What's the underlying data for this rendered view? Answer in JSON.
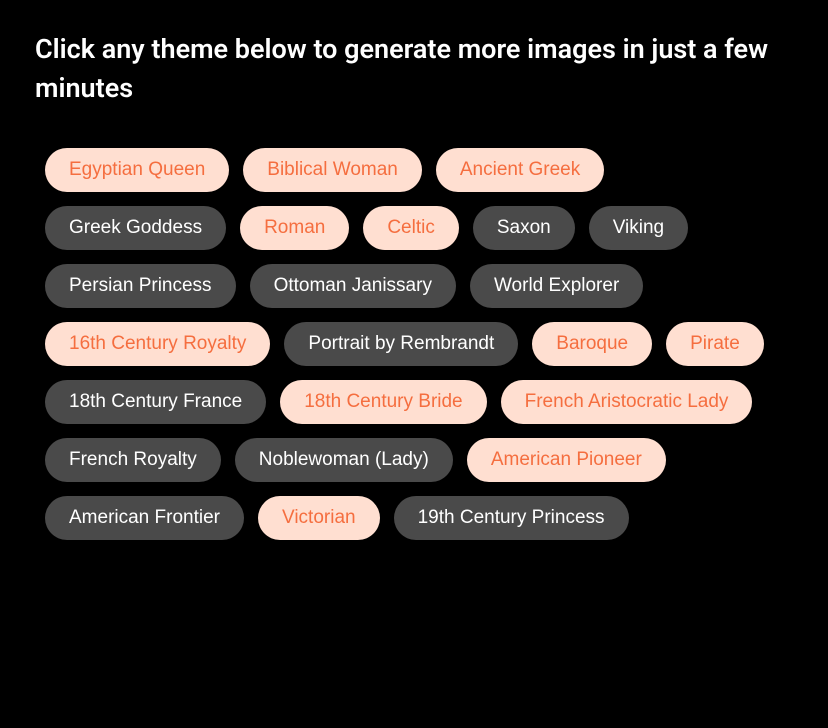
{
  "heading": "Click any theme below to generate more images in just a few minutes",
  "themes": [
    {
      "label": "Egyptian Queen",
      "variant": "light"
    },
    {
      "label": "Biblical Woman",
      "variant": "light"
    },
    {
      "label": "Ancient Greek",
      "variant": "light"
    },
    {
      "label": "Greek Goddess",
      "variant": "dark"
    },
    {
      "label": "Roman",
      "variant": "light"
    },
    {
      "label": "Celtic",
      "variant": "light"
    },
    {
      "label": "Saxon",
      "variant": "dark"
    },
    {
      "label": "Viking",
      "variant": "dark"
    },
    {
      "label": "Persian Princess",
      "variant": "dark"
    },
    {
      "label": "Ottoman Janissary",
      "variant": "dark"
    },
    {
      "label": "World Explorer",
      "variant": "dark"
    },
    {
      "label": "16th Century Royalty",
      "variant": "light"
    },
    {
      "label": "Portrait by Rembrandt",
      "variant": "dark"
    },
    {
      "label": "Baroque",
      "variant": "light"
    },
    {
      "label": "Pirate",
      "variant": "light"
    },
    {
      "label": "18th Century France",
      "variant": "dark"
    },
    {
      "label": "18th Century Bride",
      "variant": "light"
    },
    {
      "label": "French Aristocratic Lady",
      "variant": "light"
    },
    {
      "label": "French Royalty",
      "variant": "dark"
    },
    {
      "label": "Noblewoman (Lady)",
      "variant": "dark"
    },
    {
      "label": "American Pioneer",
      "variant": "light"
    },
    {
      "label": "American Frontier",
      "variant": "dark"
    },
    {
      "label": "Victorian",
      "variant": "light"
    },
    {
      "label": "19th Century Princess",
      "variant": "dark"
    }
  ]
}
